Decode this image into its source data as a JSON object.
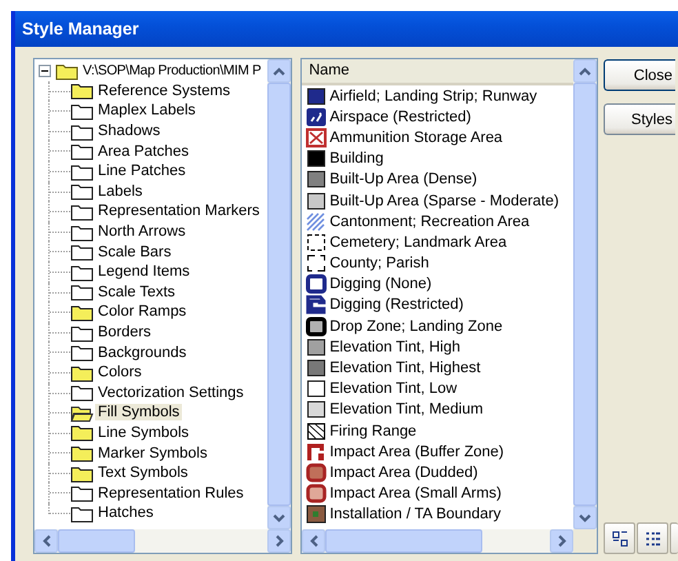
{
  "window": {
    "title": "Style Manager"
  },
  "tree": {
    "root": {
      "label": "V:\\SOP\\Map Production\\MIM P",
      "expanded": true,
      "children": [
        {
          "label": "Reference Systems",
          "filled": true,
          "selected": false
        },
        {
          "label": "Maplex Labels",
          "filled": false,
          "selected": false
        },
        {
          "label": "Shadows",
          "filled": false,
          "selected": false
        },
        {
          "label": "Area Patches",
          "filled": false,
          "selected": false
        },
        {
          "label": "Line Patches",
          "filled": false,
          "selected": false
        },
        {
          "label": "Labels",
          "filled": false,
          "selected": false
        },
        {
          "label": "Representation Markers",
          "filled": false,
          "selected": false
        },
        {
          "label": "North Arrows",
          "filled": false,
          "selected": false
        },
        {
          "label": "Scale Bars",
          "filled": false,
          "selected": false
        },
        {
          "label": "Legend Items",
          "filled": false,
          "selected": false
        },
        {
          "label": "Scale Texts",
          "filled": false,
          "selected": false
        },
        {
          "label": "Color Ramps",
          "filled": true,
          "selected": false
        },
        {
          "label": "Borders",
          "filled": false,
          "selected": false
        },
        {
          "label": "Backgrounds",
          "filled": false,
          "selected": false
        },
        {
          "label": "Colors",
          "filled": true,
          "selected": false
        },
        {
          "label": "Vectorization Settings",
          "filled": false,
          "selected": false
        },
        {
          "label": "Fill Symbols",
          "filled": true,
          "selected": true
        },
        {
          "label": "Line Symbols",
          "filled": true,
          "selected": false
        },
        {
          "label": "Marker Symbols",
          "filled": true,
          "selected": false
        },
        {
          "label": "Text Symbols",
          "filled": true,
          "selected": false
        },
        {
          "label": "Representation Rules",
          "filled": false,
          "selected": false
        },
        {
          "label": "Hatches",
          "filled": false,
          "selected": false
        }
      ]
    }
  },
  "list": {
    "column": "Name",
    "items": [
      {
        "name": "Airfield; Landing Strip; Runway",
        "kind": "solid",
        "color": "#1f2a8c"
      },
      {
        "name": "Airspace (Restricted)",
        "kind": "airspace",
        "color": "#1f2a8c"
      },
      {
        "name": "Ammunition Storage Area",
        "kind": "crossed",
        "color": "#c03030"
      },
      {
        "name": "Building",
        "kind": "solid",
        "color": "#000000"
      },
      {
        "name": "Built-Up Area (Dense)",
        "kind": "solid",
        "color": "#808080"
      },
      {
        "name": "Built-Up Area (Sparse - Moderate)",
        "kind": "solid",
        "color": "#c8c8c8"
      },
      {
        "name": "Cantonment; Recreation Area",
        "kind": "hatch",
        "color": "#6f8fe0"
      },
      {
        "name": "Cemetery; Landmark Area",
        "kind": "dashed",
        "color": "#000000"
      },
      {
        "name": "County; Parish",
        "kind": "corners",
        "color": "#000000"
      },
      {
        "name": "Digging (None)",
        "kind": "ring",
        "color": "#1f2a8c"
      },
      {
        "name": "Digging (Restricted)",
        "kind": "notch",
        "color": "#1f2a8c"
      },
      {
        "name": "Drop Zone; Landing Zone",
        "kind": "dropzone",
        "color": "#000000"
      },
      {
        "name": "Elevation Tint, High",
        "kind": "solid",
        "color": "#a0a0a0"
      },
      {
        "name": "Elevation Tint, Highest",
        "kind": "solid",
        "color": "#787878"
      },
      {
        "name": "Elevation Tint, Low",
        "kind": "solid",
        "color": "#ffffff"
      },
      {
        "name": "Elevation Tint, Medium",
        "kind": "solid",
        "color": "#d8d8d8"
      },
      {
        "name": "Firing Range",
        "kind": "diagonal",
        "color": "#000000"
      },
      {
        "name": "Impact Area (Buffer Zone)",
        "kind": "buffer",
        "color": "#b02020"
      },
      {
        "name": "Impact Area (Dudded)",
        "kind": "rounded",
        "color": "#c0705a"
      },
      {
        "name": "Impact Area (Small Arms)",
        "kind": "rounded",
        "color": "#e0a898"
      },
      {
        "name": "Installation / TA Boundary",
        "kind": "installation",
        "color": "#8a5a40"
      }
    ]
  },
  "buttons": [
    "Close",
    "Styles"
  ]
}
